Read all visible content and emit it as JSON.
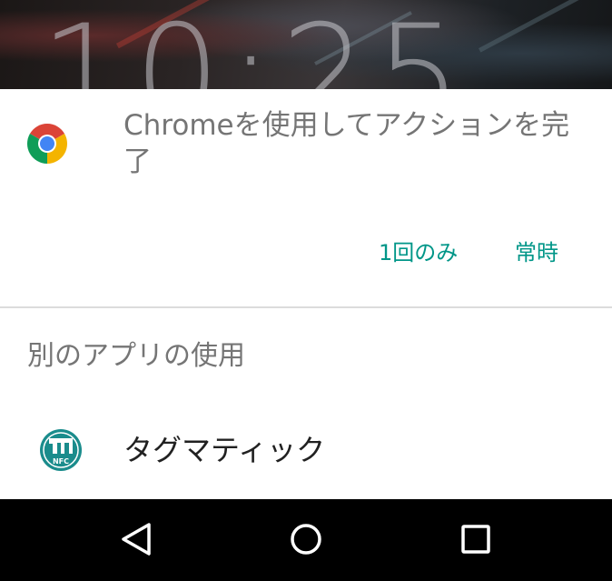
{
  "lockscreen": {
    "clock": "10:25"
  },
  "chooser": {
    "default_app": {
      "icon": "chrome-icon",
      "title": "Chromeを使用してアクションを完了"
    },
    "actions": {
      "just_once": "1回のみ",
      "always": "常時"
    },
    "other_apps_heading": "別のアプリの使用",
    "apps": [
      {
        "icon": "tagmatic-nfc-icon",
        "label": "タグマティック",
        "icon_text": "NFC"
      }
    ]
  },
  "colors": {
    "accent": "#009688",
    "secondary_text": "#757575",
    "primary_text": "#212121",
    "divider": "#dcdcdc",
    "navbar": "#000000"
  },
  "navbar": {
    "buttons": [
      "back-icon",
      "home-icon",
      "recents-icon"
    ]
  }
}
